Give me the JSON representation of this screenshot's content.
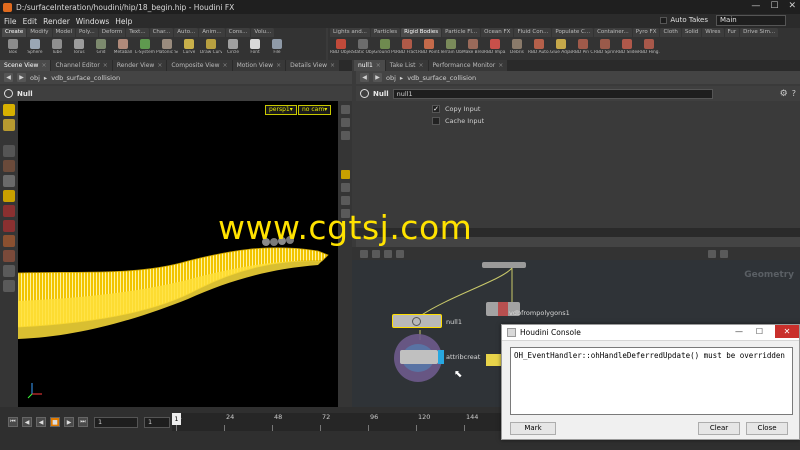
{
  "window": {
    "title": "D:/surfaceInteration/houdini/hip/18_begin.hip - Houdini FX",
    "min": "—",
    "max": "☐",
    "close": "✕"
  },
  "menu": {
    "items": [
      "File",
      "Edit",
      "Render",
      "Windows",
      "Help"
    ],
    "auto_takes": "Auto Takes",
    "desktop": "Main"
  },
  "shelf_left": {
    "tabs": [
      "Create",
      "Modify",
      "Model",
      "Poly...",
      "Deform",
      "Text...",
      "Char...",
      "Auto...",
      "Anim...",
      "Cons...",
      "Volu..."
    ],
    "tools": [
      {
        "label": "Box",
        "color": "#8c8c8c"
      },
      {
        "label": "Sphere",
        "color": "#9aa7b5"
      },
      {
        "label": "Tube",
        "color": "#8f8f8f"
      },
      {
        "label": "Torus",
        "color": "#9c9c9c"
      },
      {
        "label": "Grid",
        "color": "#7d8a6e"
      },
      {
        "label": "Metaball",
        "color": "#b08a7a"
      },
      {
        "label": "L-System",
        "color": "#5f9a4f"
      },
      {
        "label": "Platonic So...",
        "color": "#9a8c7e"
      },
      {
        "label": "Curve",
        "color": "#c9b04a"
      },
      {
        "label": "Draw Curve",
        "color": "#b8a040"
      },
      {
        "label": "Circle",
        "color": "#a0a0a0"
      },
      {
        "label": "Font",
        "color": "#d8d8d8"
      },
      {
        "label": "File",
        "color": "#8f9aa8"
      }
    ]
  },
  "shelf_right": {
    "tabs": [
      "Lights and...",
      "Particles",
      "Rigid Bodies",
      "Particle Fl...",
      "Ocean FX",
      "Fluid Con...",
      "Populate C...",
      "Container...",
      "Pyro FX",
      "Cloth",
      "Solid",
      "Wires",
      "Fur",
      "Drive Sim..."
    ],
    "active_tab": "Rigid Bodies",
    "tools": [
      {
        "label": "RBD Object",
        "color": "#c24a3a"
      },
      {
        "label": "Static Object",
        "color": "#6c6c6c"
      },
      {
        "label": "Ground Plane",
        "color": "#6f8a4f"
      },
      {
        "label": "RBD Fract...",
        "color": "#b05a48"
      },
      {
        "label": "RBD Point...",
        "color": "#c56a4a"
      },
      {
        "label": "Terrain Ob...",
        "color": "#7a8a5a"
      },
      {
        "label": "Make Brea...",
        "color": "#9a6a5a"
      },
      {
        "label": "RBD Impa...",
        "color": "#c9504a"
      },
      {
        "label": "Debris",
        "color": "#8a7a6a"
      },
      {
        "label": "RBD Auto...",
        "color": "#b5604a"
      },
      {
        "label": "Glue Adjac...",
        "color": "#c6a84a"
      },
      {
        "label": "RBD Pin C...",
        "color": "#a05a4a"
      },
      {
        "label": "RBD Spring...",
        "color": "#9a5a4a"
      },
      {
        "label": "RBD Slider...",
        "color": "#b0584a"
      },
      {
        "label": "RBD Hing...",
        "color": "#a8584a"
      }
    ]
  },
  "left_panetabs": [
    "Scene View",
    "Channel Editor",
    "Render View",
    "Composite View",
    "Motion View",
    "Details View"
  ],
  "right_panetabs": [
    "null1",
    "Take List",
    "Performance Monitor"
  ],
  "viewer": {
    "path_root": "obj",
    "path_node": "vdb_surface_collision",
    "node_type": "Null",
    "persp": "persp1▾",
    "cam": "no cam▾"
  },
  "params": {
    "node_type": "Null",
    "node_name": "null1",
    "copy_input": "Copy Input",
    "cache_input": "Cache Input"
  },
  "network": {
    "context": "Geometry",
    "nodes": {
      "vdb": "vdbfrompolygons1",
      "null": "null1",
      "attrib": "attribcreat"
    }
  },
  "watermark": "www.cgtsj.com",
  "timeline": {
    "frame": "1",
    "start": "1",
    "ticks": [
      "1",
      "24",
      "48",
      "72",
      "96",
      "120",
      "144"
    ]
  },
  "console": {
    "title": "Houdini Console",
    "message": "OH_EventHandler::ohHandleDeferredUpdate() must be overridden",
    "mark": "Mark",
    "clear": "Clear",
    "close": "Close"
  },
  "colors": {
    "accent": "#ffe200",
    "viewport_bg": "#000000",
    "network_bg": "#2f3337"
  }
}
